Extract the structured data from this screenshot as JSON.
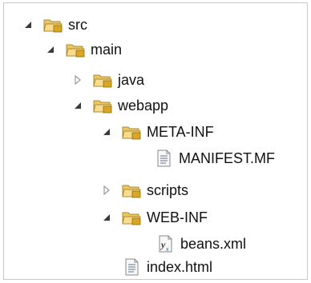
{
  "tree": {
    "items": [
      {
        "label": "src",
        "icon": "folder-icon",
        "state": "expanded",
        "depth": 0
      },
      {
        "label": "main",
        "icon": "folder-icon",
        "state": "expanded",
        "depth": 1
      },
      {
        "label": "java",
        "icon": "folder-icon",
        "state": "collapsed",
        "depth": 2
      },
      {
        "label": "webapp",
        "icon": "folder-icon",
        "state": "expanded",
        "depth": 2
      },
      {
        "label": "META-INF",
        "icon": "folder-icon",
        "state": "expanded",
        "depth": 3
      },
      {
        "label": "MANIFEST.MF",
        "icon": "text-file-icon",
        "state": "leaf",
        "depth": 4
      },
      {
        "label": "scripts",
        "icon": "folder-icon",
        "state": "collapsed",
        "depth": 3
      },
      {
        "label": "WEB-INF",
        "icon": "folder-icon",
        "state": "expanded",
        "depth": 3
      },
      {
        "label": "beans.xml",
        "icon": "xml-file-icon",
        "state": "leaf",
        "depth": 4
      },
      {
        "label": "index.html",
        "icon": "html-file-icon",
        "state": "leaf",
        "depth": 3
      }
    ]
  },
  "colors": {
    "folder_body": "#f3d77a",
    "folder_edge": "#b08a2e",
    "arrow_expanded": "#3a3a3a",
    "arrow_collapsed": "#9a9a9a"
  }
}
